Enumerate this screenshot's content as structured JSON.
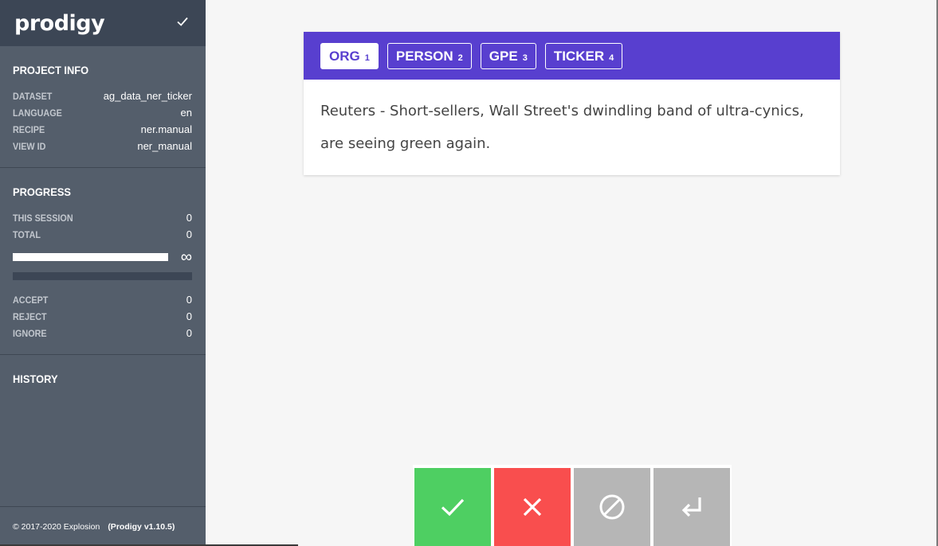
{
  "sidebar": {
    "logo": "prodigy",
    "project_info": {
      "title": "PROJECT INFO",
      "rows": [
        {
          "key": "DATASET",
          "value": "ag_data_ner_ticker"
        },
        {
          "key": "LANGUAGE",
          "value": "en"
        },
        {
          "key": "RECIPE",
          "value": "ner.manual"
        },
        {
          "key": "VIEW ID",
          "value": "ner_manual"
        }
      ]
    },
    "progress": {
      "title": "PROGRESS",
      "this_session_label": "THIS SESSION",
      "this_session_value": "0",
      "total_label": "TOTAL",
      "total_value": "0",
      "infinity": "∞",
      "accept_label": "ACCEPT",
      "accept_value": "0",
      "reject_label": "REJECT",
      "reject_value": "0",
      "ignore_label": "IGNORE",
      "ignore_value": "0"
    },
    "history": {
      "title": "HISTORY"
    },
    "footer": {
      "copyright": "© 2017-2020 Explosion",
      "version": "(Prodigy v1.10.5)"
    }
  },
  "card": {
    "labels": [
      {
        "name": "ORG",
        "key": "1",
        "active": true
      },
      {
        "name": "PERSON",
        "key": "2",
        "active": false
      },
      {
        "name": "GPE",
        "key": "3",
        "active": false
      },
      {
        "name": "TICKER",
        "key": "4",
        "active": false
      }
    ],
    "text": "Reuters - Short-sellers, Wall Street's dwindling band of ultra-cynics, are seeing green again."
  },
  "actions": [
    {
      "name": "accept",
      "icon": "check-icon",
      "color": "#4ecf62"
    },
    {
      "name": "reject",
      "icon": "close-icon",
      "color": "#f94e4e"
    },
    {
      "name": "ignore",
      "icon": "ban-icon",
      "color": "#b6b6b6"
    },
    {
      "name": "undo",
      "icon": "undo-icon",
      "color": "#b6b6b6"
    }
  ],
  "colors": {
    "sidebar": "#545e6b",
    "sidebar_header": "#3c4655",
    "accent": "#583fcf"
  }
}
